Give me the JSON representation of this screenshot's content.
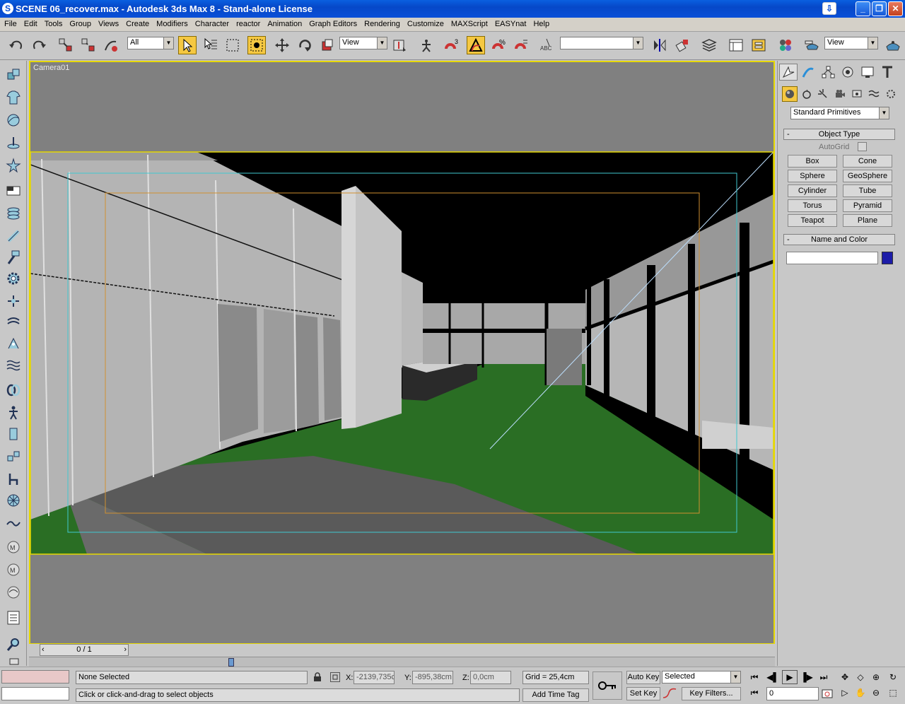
{
  "window": {
    "title": "SCENE 06_recover.max - Autodesk 3ds Max 8  - Stand-alone License",
    "app_icon": "3ds-max-icon"
  },
  "menu": [
    "File",
    "Edit",
    "Tools",
    "Group",
    "Views",
    "Create",
    "Modifiers",
    "Character",
    "reactor",
    "Animation",
    "Graph Editors",
    "Rendering",
    "Customize",
    "MAXScript",
    "EASYnat",
    "Help"
  ],
  "toolbar": {
    "selection_filter": "All",
    "ref_coord": "View",
    "named_selection": "",
    "render_view": "View"
  },
  "viewport": {
    "label": "Camera01",
    "border_color": "#e6d800",
    "floor_color": "#2a6e24"
  },
  "command_panel": {
    "category": "Standard Primitives",
    "object_type_header": "Object Type",
    "autogrid_label": "AutoGrid",
    "buttons": [
      "Box",
      "Cone",
      "Sphere",
      "GeoSphere",
      "Cylinder",
      "Tube",
      "Torus",
      "Pyramid",
      "Teapot",
      "Plane"
    ],
    "name_color_header": "Name and Color",
    "object_name": "",
    "object_color": "#1c1ca8"
  },
  "timeline": {
    "frame": "0 / 1"
  },
  "status": {
    "selection": "None Selected",
    "prompt": "Click or click-and-drag to select objects",
    "x_label": "X:",
    "x_value": "-2139,735c",
    "y_label": "Y:",
    "y_value": "-895,38cm",
    "z_label": "Z:",
    "z_value": "0,0cm",
    "grid": "Grid = 25,4cm",
    "add_time_tag": "Add Time Tag",
    "auto_key": "Auto Key",
    "set_key": "Set Key",
    "key_mode": "Selected",
    "key_filters": "Key Filters...",
    "current_frame": "0"
  }
}
